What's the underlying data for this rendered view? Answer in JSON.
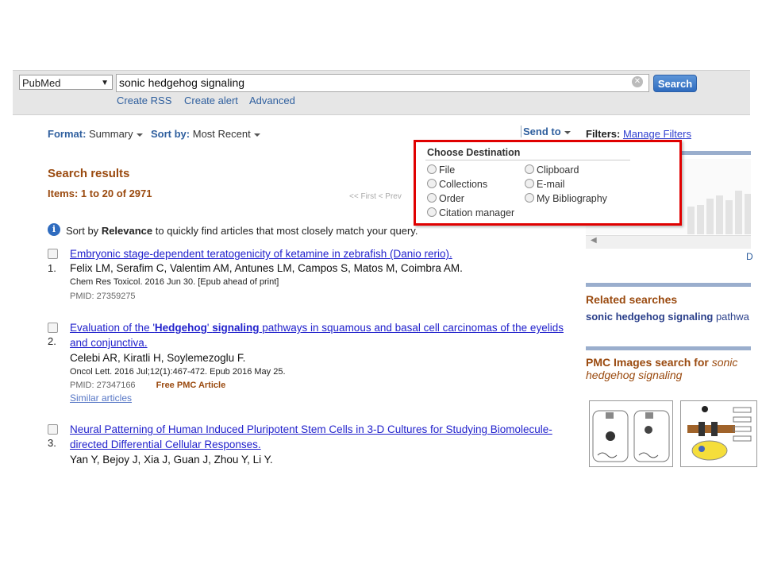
{
  "search": {
    "database": "PubMed",
    "term": "sonic hedgehog signaling",
    "button": "Search",
    "links": [
      "Create RSS",
      "Create alert",
      "Advanced"
    ]
  },
  "toolbar": {
    "format_label": "Format",
    "format_value": "Summary",
    "sort_label": "Sort by",
    "sort_value": "Most Recent",
    "send_to": "Send to",
    "filters_label": "Filters:",
    "filters_link": "Manage Filters"
  },
  "results": {
    "title": "Search results",
    "count": "Items: 1 to 20 of 2971",
    "pager": "<< First   < Prev",
    "sort_tip_pre": "Sort by",
    "sort_tip_bold": "Relevance",
    "sort_tip_post": "to quickly find articles that most closely match your query.",
    "items": [
      {
        "num": "1.",
        "title": "Embryonic stage-dependent teratogenicity of ketamine in zebrafish (Danio rerio).",
        "authors": "Felix LM, Serafim C, Valentim AM, Antunes LM, Campos S, Matos M, Coimbra AM.",
        "journal": "Chem Res Toxicol. 2016 Jun 30. [Epub ahead of print]",
        "pmid": "PMID: 27359275"
      },
      {
        "num": "2.",
        "title_pre": "Evaluation of the '",
        "title_b1": "Hedgehog",
        "title_mid": "' ",
        "title_b2": "signaling",
        "title_post": " pathways in squamous and basal cell carcinomas of the eyelids and conjunctiva.",
        "authors": "Celebi AR, Kiratli H, Soylemezoglu F.",
        "journal": "Oncol Lett. 2016 Jul;12(1):467-472. Epub 2016 May 25.",
        "pmid": "PMID: 27347166",
        "free": "Free PMC Article",
        "similar": "Similar articles"
      },
      {
        "num": "3.",
        "title": "Neural Patterning of Human Induced Pluripotent Stem Cells in 3-D Cultures for Studying Biomolecule-directed Differential Cellular Responses.",
        "authors": "Yan Y, Bejoy J, Xia J, Guan J, Zhou Y, Li Y."
      }
    ]
  },
  "send_to_popup": {
    "title": "Choose Destination",
    "options": [
      "File",
      "Clipboard",
      "Collections",
      "E-mail",
      "Order",
      "My Bibliography",
      "Citation manager"
    ]
  },
  "sidebar": {
    "d_link": "D",
    "related_title": "Related searches",
    "related_bold": "sonic hedgehog signaling",
    "related_rest": " pathwa",
    "pmc_title": "PMC Images search for",
    "pmc_term": "sonic hedgehog signaling"
  },
  "colors": {
    "accent": "#9a4a0f",
    "link": "#2222cc",
    "highlight_border": "#e00000",
    "button": "#2f6cbf"
  }
}
